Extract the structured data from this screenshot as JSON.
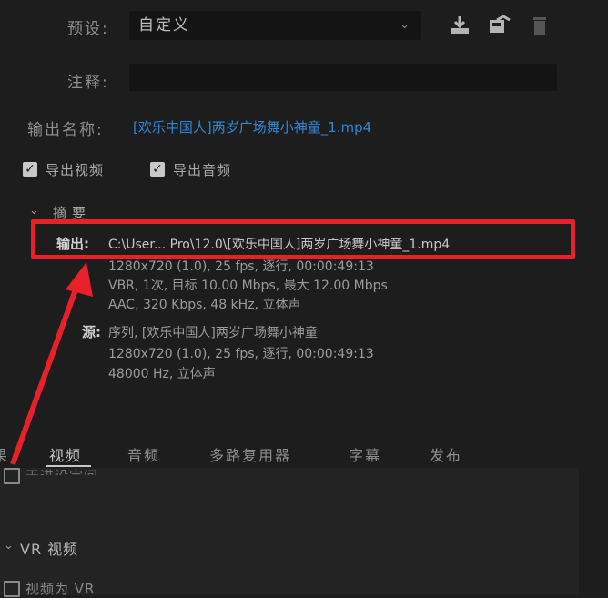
{
  "preset": {
    "label": "预设:",
    "value": "自定义"
  },
  "comment": {
    "label": "注释:",
    "value": ""
  },
  "output_name": {
    "label": "输出名称:",
    "value": "[欢乐中国人]两岁广场舞小神童_1.mp4"
  },
  "export_video": {
    "label": "导出视频",
    "checked": true
  },
  "export_audio": {
    "label": "导出音频",
    "checked": true
  },
  "summary": {
    "title": "摘要",
    "output_label": "输出:",
    "output_path": "C:\\User... Pro\\12.0\\[欢乐中国人]两岁广场舞小神童_1.mp4",
    "output_line2": "1280x720 (1.0), 25 fps, 逐行, 00:00:49:13",
    "output_line3": "VBR, 1次, 目标 10.00 Mbps, 最大 12.00 Mbps",
    "output_line4": "AAC, 320 Kbps, 48 kHz, 立体声",
    "source_label": "源:",
    "source_line1": "序列, [欢乐中国人]两岁广场舞小神童",
    "source_line2": "1280x720 (1.0), 25 fps, 逐行, 00:00:49:13",
    "source_line3": "48000 Hz, 立体声"
  },
  "tabs": [
    "视频",
    "音频",
    "多路复用器",
    "字幕",
    "发布"
  ],
  "active_tab": "视频",
  "partial_tab_left": "果",
  "basic_settings_partial": "天进设定间",
  "vr_section": {
    "title": "VR 视频",
    "checkbox_label": "视频为 VR"
  },
  "colors": {
    "highlight": "#e8202a",
    "link": "#2f86d6",
    "background": "#1d1d1d"
  }
}
